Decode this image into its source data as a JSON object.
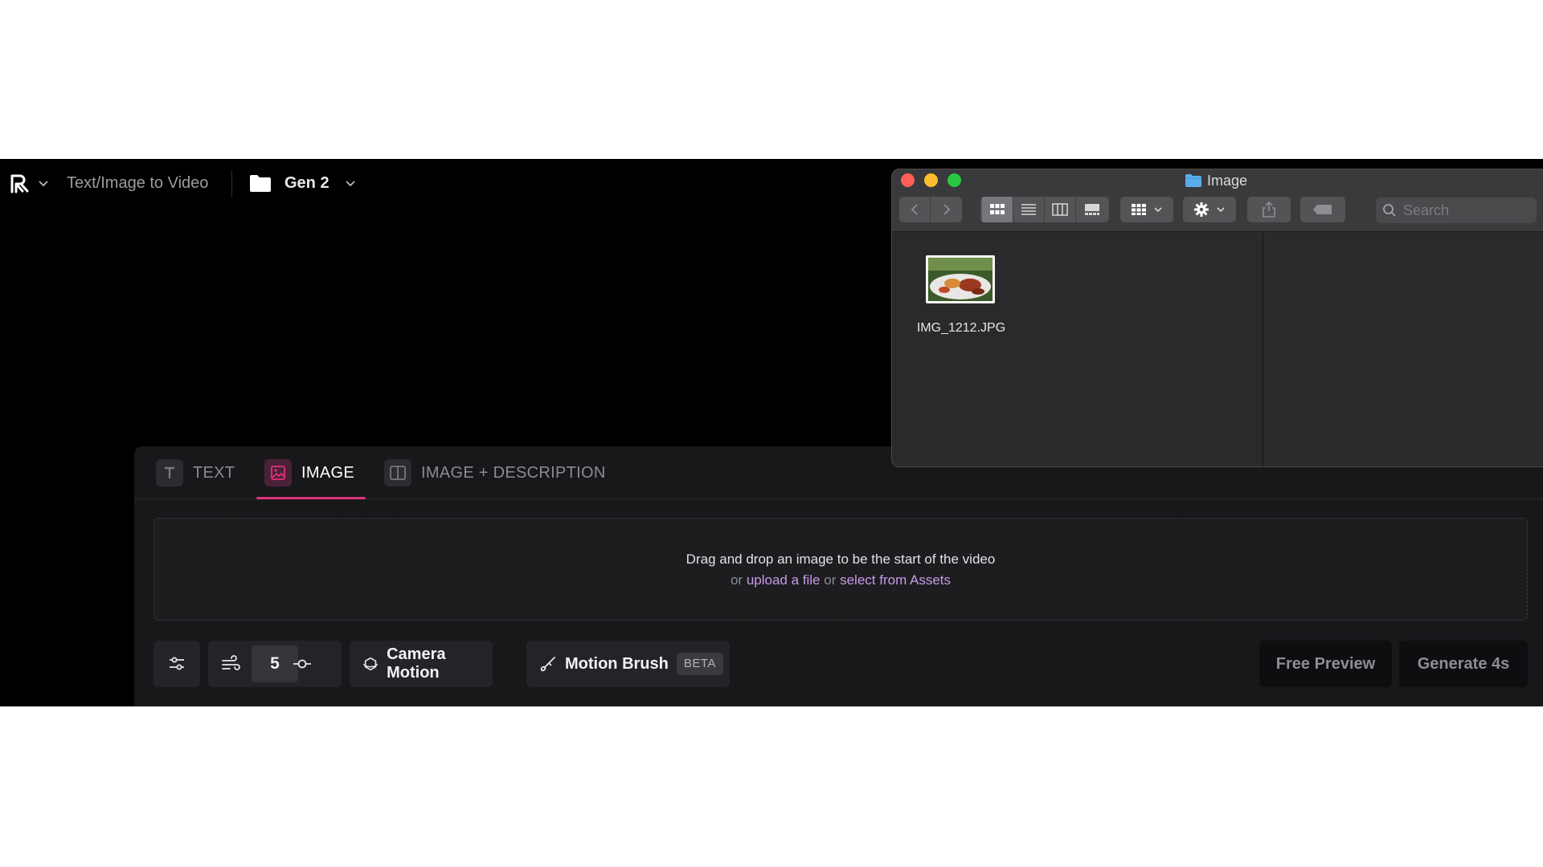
{
  "app": {
    "breadcrumb": "Text/Image to Video",
    "project": "Gen 2"
  },
  "tabs": [
    {
      "label": "TEXT",
      "icon": "text-icon"
    },
    {
      "label": "IMAGE",
      "icon": "image-icon",
      "active": true
    },
    {
      "label": "IMAGE + DESCRIPTION",
      "icon": "split-layout-icon"
    }
  ],
  "dropzone": {
    "main": "Drag and drop an image to be the start of the video",
    "or1": "or",
    "upload_link": "upload a file",
    "or2": "or",
    "assets_link": "select from Assets"
  },
  "toolbar": {
    "general_motion_value": "5",
    "camera_motion": "Camera Motion",
    "motion_brush": "Motion Brush",
    "beta_badge": "BETA",
    "free_preview": "Free Preview",
    "generate": "Generate 4s"
  },
  "finder": {
    "title": "Image",
    "search_placeholder": "Search",
    "files": [
      {
        "name": "IMG_1212.JPG"
      }
    ]
  },
  "colors": {
    "accent": "#e0337a",
    "link": "#c79ae8",
    "close": "#ff5f57",
    "minimize": "#febc2e",
    "zoom": "#28c840"
  }
}
